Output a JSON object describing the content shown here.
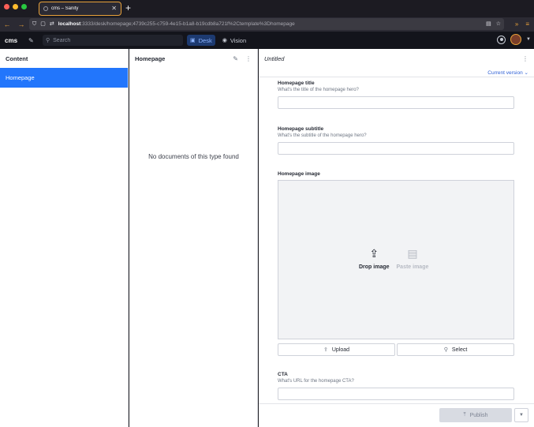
{
  "browser": {
    "tab_title": "cms – Sanity",
    "url_host": "localhost",
    "url_rest": ":3333/desk/homepage;4739c255-c759-4e15-b1a8-b19cdb8a721f%2Ctemplate%3Dhomepage",
    "colors": {
      "accent": "#e8a13a",
      "chrome": "#2b2a33"
    }
  },
  "navbar": {
    "brand": "cms",
    "search_placeholder": "Search",
    "tabs": [
      {
        "label": "Desk",
        "icon": "desk-icon",
        "active": true
      },
      {
        "label": "Vision",
        "icon": "eye-icon",
        "active": false
      }
    ]
  },
  "content_pane": {
    "title": "Content",
    "items": [
      {
        "label": "Homepage",
        "selected": true
      }
    ]
  },
  "list_pane": {
    "title": "Homepage",
    "empty_message": "No documents of this type found"
  },
  "document_pane": {
    "title": "Untitled",
    "version_label": "Current version",
    "fields": {
      "title": {
        "label": "Homepage title",
        "description": "What's the title of the homepage hero?",
        "value": ""
      },
      "subtitle": {
        "label": "Homepage subtitle",
        "description": "What's the subtitle of the homepage hero?",
        "value": ""
      },
      "image": {
        "label": "Homepage image",
        "drop_label": "Drop image",
        "paste_label": "Paste image",
        "upload_label": "Upload",
        "select_label": "Select"
      },
      "cta": {
        "label": "CTA",
        "description": "What's URL for the homepage CTA?",
        "value": ""
      }
    },
    "publish_label": "Publish"
  }
}
